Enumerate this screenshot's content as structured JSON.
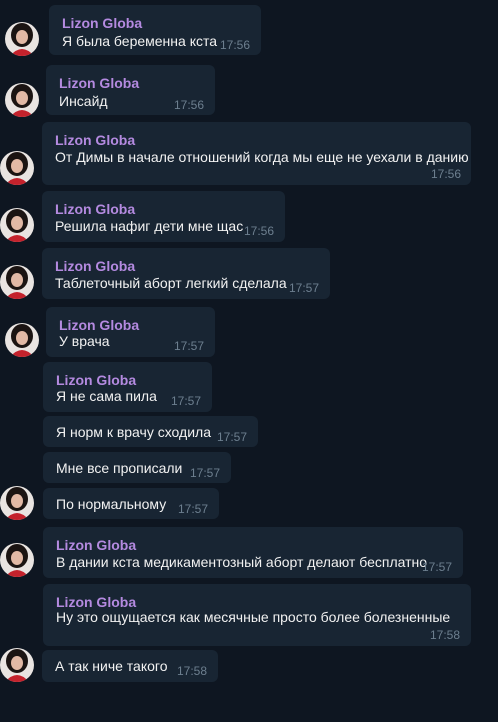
{
  "chat": {
    "background": "#0e1621",
    "bubble_color": "#182533",
    "sender_color": "#b48ae0",
    "messages": [
      {
        "sender": "Lizon Globa",
        "text": "Я была беременна кста",
        "time": "17:56"
      },
      {
        "sender": "Lizon Globa",
        "text": "Инсайд",
        "time": "17:56"
      },
      {
        "sender": "Lizon Globa",
        "text": "От Димы в начале отношений когда мы еще не уехали в данию",
        "time": "17:56"
      },
      {
        "sender": "Lizon Globa",
        "text": "Решила нафиг дети мне щас",
        "time": "17:56"
      },
      {
        "sender": "Lizon Globa",
        "text": "Таблеточный аборт легкий сделала",
        "time": "17:57"
      },
      {
        "sender": "Lizon Globa",
        "text": "У врача",
        "time": "17:57"
      },
      {
        "sender": "Lizon Globa",
        "text": "Я не сама пила",
        "time": "17:57"
      },
      {
        "text": "Я норм к врачу сходила",
        "time": "17:57"
      },
      {
        "text": "Мне все прописали",
        "time": "17:57"
      },
      {
        "text": "По нормальному",
        "time": "17:57"
      },
      {
        "sender": "Lizon Globa",
        "text": "В дании кста медикаментозный аборт делают бесплатно",
        "time": "17:57"
      },
      {
        "sender": "Lizon Globa",
        "text": "Ну это ощущается как месячные просто более болезненные",
        "time": "17:58"
      },
      {
        "text": "А так ниче такого",
        "time": "17:58"
      }
    ]
  }
}
